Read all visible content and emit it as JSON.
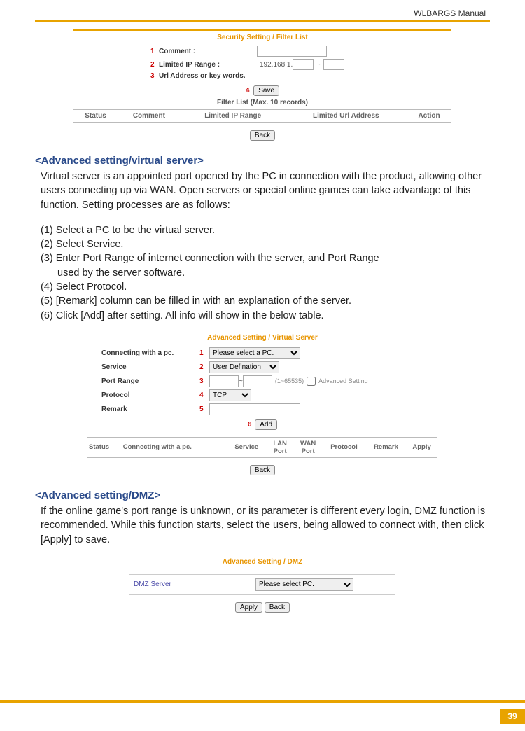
{
  "header": {
    "title": "WLBARGS Manual"
  },
  "page_number": "39",
  "shot1": {
    "title": "Security Setting / Filter List",
    "num1": "1",
    "lbl1": "Comment :",
    "num2": "2",
    "lbl2": "Limited IP Range :",
    "ip_prefix": "192.168.1.",
    "num3": "3",
    "lbl3": "Url Address or key words.",
    "num4": "4",
    "save_btn": "Save",
    "list_title": "Filter List (Max. 10 records)",
    "th_status": "Status",
    "th_comment": "Comment",
    "th_iprange": "Limited IP Range",
    "th_url": "Limited Url Address",
    "th_action": "Action",
    "back_btn": "Back"
  },
  "section1": {
    "title": "<Advanced setting/virtual server>",
    "para": "Virtual server is an appointed port opened by the PC in connection with the product, allowing other users connecting up via WAN.  Open servers or special online games can take advantage of this function.  Setting processes are as follows:",
    "s1": "(1) Select a PC to be the virtual server.",
    "s2": "(2) Select Service.",
    "s3": "(3) Enter Port Range of internet connection with the server, and Port Range",
    "s3b": "used by the server software.",
    "s4": "(4) Select Protocol.",
    "s5": "(5) [Remark] column can be filled in with an explanation of the server.",
    "s6": "(6) Click [Add] after setting.  All info will show in the below table."
  },
  "shot2": {
    "title": "Advanced Setting / Virtual Server",
    "lbl1": "Connecting with a pc.",
    "num1": "1",
    "sel1": "Please select a PC.",
    "lbl2": "Service",
    "num2": "2",
    "sel2": "User Defination",
    "lbl3": "Port Range",
    "num3": "3",
    "hint3": "(1~65535)",
    "chk3": "Advanced Setting",
    "lbl4": "Protocol",
    "num4": "4",
    "sel4": "TCP",
    "lbl5": "Remark",
    "num5": "5",
    "num6": "6",
    "add_btn": "Add",
    "th_status": "Status",
    "th_conn": "Connecting with a pc.",
    "th_service": "Service",
    "th_lan": "LAN Port",
    "th_wan": "WAN Port",
    "th_protocol": "Protocol",
    "th_remark": "Remark",
    "th_apply": "Apply",
    "back_btn": "Back"
  },
  "section2": {
    "title": "<Advanced setting/DMZ>",
    "para": "If the online game's port range is unknown, or its parameter is different every login, DMZ function is recommended. While this function starts, select the users, being allowed to connect with, then click [Apply] to save."
  },
  "shot3": {
    "title": "Advanced Setting / DMZ",
    "lbl": "DMZ Server",
    "sel": "Please select PC.",
    "apply_btn": "Apply",
    "back_btn": "Back"
  }
}
